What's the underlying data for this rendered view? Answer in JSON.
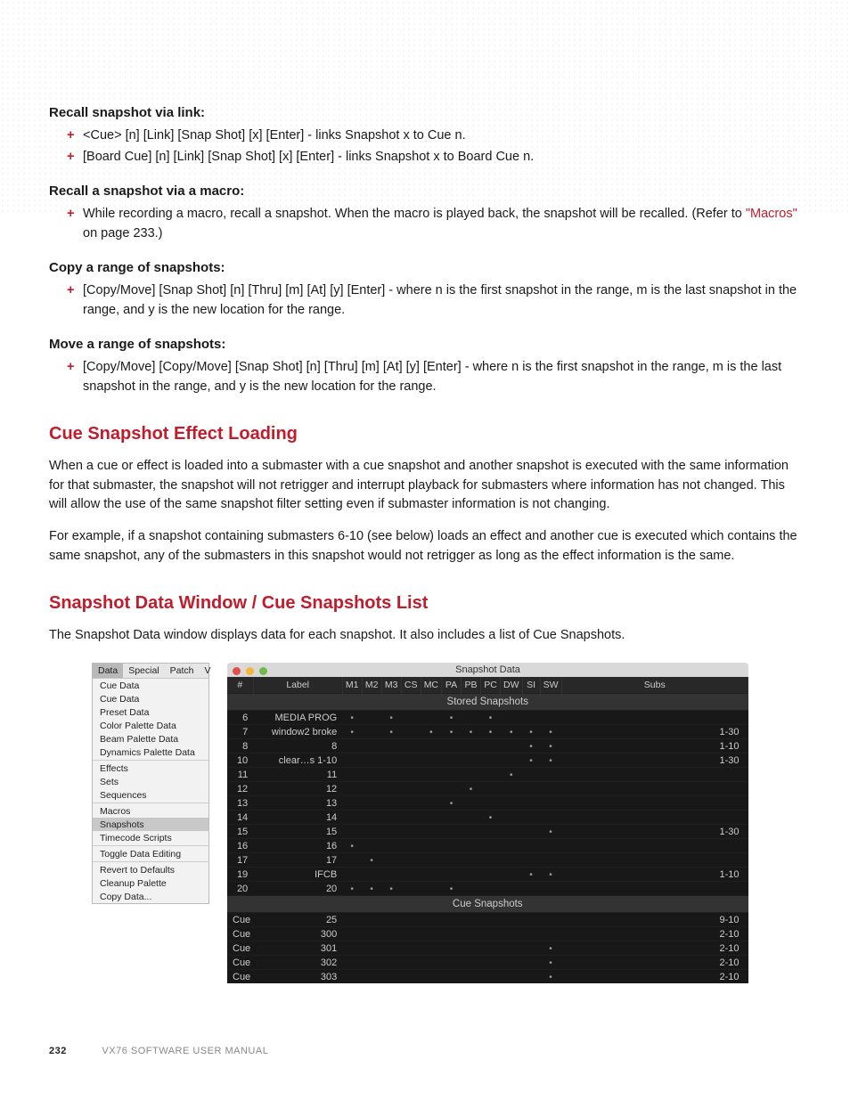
{
  "doc": {
    "sections": {
      "recall_link": {
        "heading": "Recall snapshot via link:",
        "items": [
          "<Cue> [n] [Link] [Snap Shot] [x] [Enter] - links Snapshot x to Cue n.",
          "[Board Cue] [n] [Link] [Snap Shot] [x] [Enter] - links Snapshot x to Board Cue n."
        ]
      },
      "recall_macro": {
        "heading": "Recall a snapshot via a macro:",
        "item_prefix": "While recording a macro, recall a snapshot. When the macro is played back, the snapshot will be recalled. (Refer to ",
        "item_link": "\"Macros\"",
        "item_suffix": " on page 233.)"
      },
      "copy_range": {
        "heading": "Copy a range of snapshots:",
        "items": [
          "[Copy/Move] [Snap Shot] [n] [Thru] [m] [At] [y] [Enter] - where n is the first snapshot in the range, m is the last snapshot in the range, and y is the new location for the range."
        ]
      },
      "move_range": {
        "heading": "Move a range of snapshots:",
        "items": [
          "[Copy/Move] [Copy/Move] [Snap Shot] [n] [Thru] [m] [At] [y] [Enter] - where n is the first snapshot in the range, m is the last snapshot in the range, and y is the new location for the range."
        ]
      }
    },
    "h2_loading": "Cue Snapshot Effect Loading",
    "p_loading_1": "When a cue or effect is loaded into a submaster with a cue snapshot and another snapshot is executed with the same information for that submaster, the snapshot will not retrigger and interrupt playback for submasters where information has not changed. This will allow the use of the same snapshot filter setting even if submaster information is not changing.",
    "p_loading_2": "For example, if a snapshot containing submasters 6-10 (see below) loads an effect and another cue is executed which contains the same snapshot, any of the submasters in this snapshot would not retrigger as long as the effect information is the same.",
    "h2_window": "Snapshot Data Window / Cue Snapshots List",
    "p_window": "The Snapshot Data window displays data for each snapshot. It also includes a list of Cue Snapshots."
  },
  "menu": {
    "bar": [
      "Data",
      "Special",
      "Patch",
      "V"
    ],
    "items": [
      "Cue Data",
      "Cue Data",
      "Preset Data",
      "Color Palette Data",
      "Beam Palette Data",
      "Dynamics Palette Data",
      "_sep",
      "Effects",
      "Sets",
      "Sequences",
      "_sep",
      "Macros",
      "Snapshots",
      "Timecode Scripts",
      "_sep",
      "Toggle Data Editing",
      "_sep",
      "Revert to Defaults",
      "Cleanup Palette",
      "Copy Data..."
    ],
    "highlight": "Snapshots"
  },
  "window": {
    "title": "Snapshot Data",
    "cols": [
      "#",
      "Label",
      "M1",
      "M2",
      "M3",
      "CS",
      "MC",
      "PA",
      "PB",
      "PC",
      "DW",
      "SI",
      "SW",
      "Subs"
    ],
    "stored_header": "Stored Snapshots",
    "cue_header": "Cue Snapshots",
    "rows": [
      {
        "n": "6",
        "label": "MEDIA PROG",
        "d": [
          1,
          0,
          1,
          0,
          0,
          1,
          0,
          1,
          0,
          0,
          0
        ],
        "subs": ""
      },
      {
        "n": "7",
        "label": "window2 broke",
        "d": [
          1,
          0,
          1,
          0,
          1,
          1,
          1,
          1,
          1,
          1,
          1
        ],
        "subs": "1-30"
      },
      {
        "n": "8",
        "label": "8",
        "d": [
          0,
          0,
          0,
          0,
          0,
          0,
          0,
          0,
          0,
          1,
          1
        ],
        "subs": "1-10"
      },
      {
        "n": "10",
        "label": "clear…s 1-10",
        "d": [
          0,
          0,
          0,
          0,
          0,
          0,
          0,
          0,
          0,
          1,
          1
        ],
        "subs": "1-30"
      },
      {
        "n": "11",
        "label": "11",
        "d": [
          0,
          0,
          0,
          0,
          0,
          0,
          0,
          0,
          1,
          0,
          0
        ],
        "subs": ""
      },
      {
        "n": "12",
        "label": "12",
        "d": [
          0,
          0,
          0,
          0,
          0,
          0,
          1,
          0,
          0,
          0,
          0
        ],
        "subs": ""
      },
      {
        "n": "13",
        "label": "13",
        "d": [
          0,
          0,
          0,
          0,
          0,
          1,
          0,
          0,
          0,
          0,
          0
        ],
        "subs": ""
      },
      {
        "n": "14",
        "label": "14",
        "d": [
          0,
          0,
          0,
          0,
          0,
          0,
          0,
          1,
          0,
          0,
          0
        ],
        "subs": ""
      },
      {
        "n": "15",
        "label": "15",
        "d": [
          0,
          0,
          0,
          0,
          0,
          0,
          0,
          0,
          0,
          0,
          1
        ],
        "subs": "1-30"
      },
      {
        "n": "16",
        "label": "16",
        "d": [
          1,
          0,
          0,
          0,
          0,
          0,
          0,
          0,
          0,
          0,
          0
        ],
        "subs": ""
      },
      {
        "n": "17",
        "label": "17",
        "d": [
          0,
          1,
          0,
          0,
          0,
          0,
          0,
          0,
          0,
          0,
          0
        ],
        "subs": ""
      },
      {
        "n": "19",
        "label": "IFCB",
        "d": [
          0,
          0,
          0,
          0,
          0,
          0,
          0,
          0,
          0,
          1,
          1
        ],
        "subs": "1-10"
      },
      {
        "n": "20",
        "label": "20",
        "d": [
          1,
          1,
          1,
          0,
          0,
          1,
          0,
          0,
          0,
          0,
          0
        ],
        "subs": ""
      }
    ],
    "cue_rows": [
      {
        "n": "Cue",
        "label": "25",
        "d": [
          0,
          0,
          0,
          0,
          0,
          0,
          0,
          0,
          0,
          0,
          0
        ],
        "subs": "9-10"
      },
      {
        "n": "Cue",
        "label": "300",
        "d": [
          0,
          0,
          0,
          0,
          0,
          0,
          0,
          0,
          0,
          0,
          0
        ],
        "subs": "2-10"
      },
      {
        "n": "Cue",
        "label": "301",
        "d": [
          0,
          0,
          0,
          0,
          0,
          0,
          0,
          0,
          0,
          0,
          1
        ],
        "subs": "2-10"
      },
      {
        "n": "Cue",
        "label": "302",
        "d": [
          0,
          0,
          0,
          0,
          0,
          0,
          0,
          0,
          0,
          0,
          1
        ],
        "subs": "2-10"
      },
      {
        "n": "Cue",
        "label": "303",
        "d": [
          0,
          0,
          0,
          0,
          0,
          0,
          0,
          0,
          0,
          0,
          1
        ],
        "subs": "2-10"
      }
    ]
  },
  "footer": {
    "page": "232",
    "title": "VX76 SOFTWARE USER MANUAL"
  }
}
